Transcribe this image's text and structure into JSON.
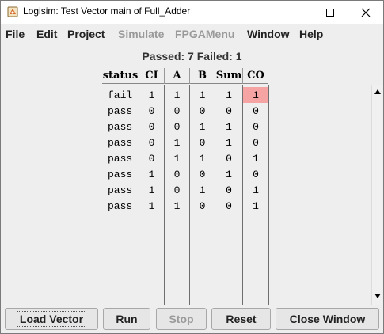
{
  "window": {
    "title": "Logisim: Test Vector main of Full_Adder",
    "controls": {
      "minimize": "minimize-icon",
      "maximize": "maximize-icon",
      "close": "close-icon"
    }
  },
  "menu": [
    "File",
    "Edit",
    "Project",
    "Simulate",
    "FPGAMenu",
    "Window",
    "Help"
  ],
  "menu_disabled": [
    "Simulate",
    "FPGAMenu"
  ],
  "summary": "Passed: 7 Failed: 1",
  "table": {
    "columns": [
      "status",
      "CI",
      "A",
      "B",
      "Sum",
      "CO"
    ],
    "rows": [
      [
        "fail",
        "1",
        "1",
        "1",
        "1",
        "1"
      ],
      [
        "pass",
        "0",
        "0",
        "0",
        "0",
        "0"
      ],
      [
        "pass",
        "0",
        "0",
        "1",
        "1",
        "0"
      ],
      [
        "pass",
        "0",
        "1",
        "0",
        "1",
        "0"
      ],
      [
        "pass",
        "0",
        "1",
        "1",
        "0",
        "1"
      ],
      [
        "pass",
        "1",
        "0",
        "0",
        "1",
        "0"
      ],
      [
        "pass",
        "1",
        "0",
        "1",
        "0",
        "1"
      ],
      [
        "pass",
        "1",
        "1",
        "0",
        "0",
        "1"
      ]
    ],
    "failed_cell": {
      "row": 0,
      "column": "CO"
    },
    "fail_color": "#f5a3a3"
  },
  "buttons": {
    "load_vector": "Load Vector",
    "run": "Run",
    "stop": "Stop",
    "reset": "Reset",
    "close_window": "Close Window"
  }
}
